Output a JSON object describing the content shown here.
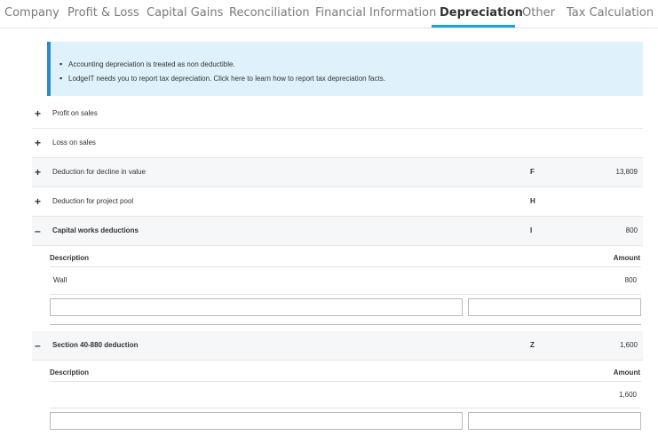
{
  "tabs": [
    {
      "label": "Company"
    },
    {
      "label": "Profit & Loss"
    },
    {
      "label": "Capital Gains"
    },
    {
      "label": "Reconciliation"
    },
    {
      "label": "Financial Information"
    },
    {
      "label": "Depreciation"
    },
    {
      "label": "Other"
    },
    {
      "label": "Tax Calculation"
    }
  ],
  "active_tab": "Depreciation",
  "info": {
    "bullets": [
      "Accounting depreciation is treated as non deductible.",
      "LodgeIT needs you to report tax depreciation. Click here to learn how to report tax depreciation facts."
    ]
  },
  "rows": [
    {
      "toggle": "+",
      "label": "Profit on sales",
      "code": "",
      "amount": ""
    },
    {
      "toggle": "+",
      "label": "Loss on sales",
      "code": "",
      "amount": ""
    },
    {
      "toggle": "+",
      "label": "Deduction for decline in value",
      "code": "F",
      "amount": "13,809"
    },
    {
      "toggle": "+",
      "label": "Deduction for project pool",
      "code": "H",
      "amount": ""
    },
    {
      "toggle": "–",
      "label": "Capital works deductions",
      "code": "I",
      "amount": "800"
    },
    {
      "toggle": "–",
      "label": "Section 40-880 deduction",
      "code": "Z",
      "amount": "1,600"
    }
  ],
  "capital_works": {
    "description_header": "Description",
    "amount_header": "Amount",
    "items": [
      {
        "description": "Wall",
        "amount": "800"
      }
    ],
    "new_description": "",
    "new_amount": ""
  },
  "section_40_880": {
    "description_header": "Description",
    "amount_header": "Amount",
    "total": "1,600",
    "new_description": "",
    "new_amount": ""
  },
  "colors": {
    "accent": "#1aa3d9",
    "info_bg": "#dff1fb",
    "info_border": "#2a8bc7"
  }
}
